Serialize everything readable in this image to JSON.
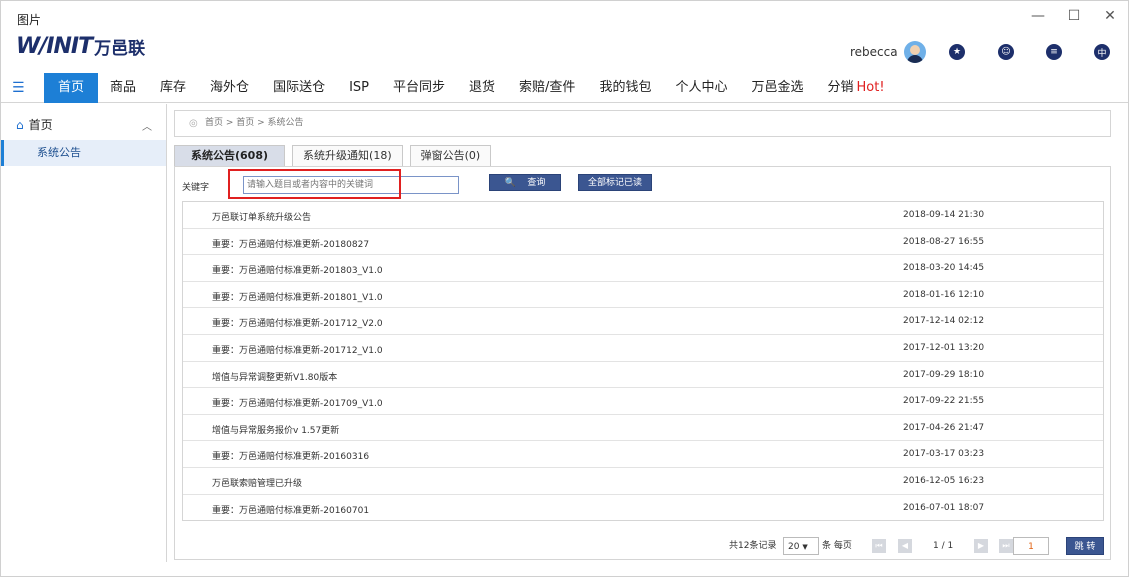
{
  "window": {
    "title": "图片",
    "minimize": "—",
    "maximize": "☐",
    "close": "✕"
  },
  "brand": {
    "mark": "W/INIT",
    "name": "万邑联"
  },
  "user": {
    "name": "rebecca",
    "icons": [
      "folder-star-icon",
      "support-agent-icon",
      "message-icon",
      "language-icon"
    ],
    "lang": "中"
  },
  "nav": {
    "menu_icon": "☰",
    "items": [
      "首页",
      "商品",
      "库存",
      "海外仓",
      "国际送仓",
      "ISP",
      "平台同步",
      "退货",
      "索赔/查件",
      "我的钱包",
      "个人中心",
      "万邑金选",
      "分销"
    ],
    "hot": "Hot!"
  },
  "sidebar": {
    "home": "首页",
    "home_icon": "⌂",
    "caret": "︿",
    "sub": "系统公告"
  },
  "breadcrumb": {
    "pin": "◎",
    "text": "首页 > 首页 > 系统公告"
  },
  "tabs": [
    "系统公告(608)",
    "系统升级通知(18)",
    "弹窗公告(0)"
  ],
  "search": {
    "label": "关键字",
    "placeholder": "请输入题目或者内容中的关键词",
    "search_label": "查询",
    "search_icon": "🔍",
    "markall_label": "全部标记已读"
  },
  "announcements": [
    {
      "title": "万邑联订单系统升级公告",
      "date": "2018-09-14 21:30"
    },
    {
      "title": "重要：万邑通赔付标准更新-20180827",
      "date": "2018-08-27 16:55"
    },
    {
      "title": "重要：万邑通赔付标准更新-201803_V1.0",
      "date": "2018-03-20 14:45"
    },
    {
      "title": "重要：万邑通赔付标准更新-201801_V1.0",
      "date": "2018-01-16 12:10"
    },
    {
      "title": "重要：万邑通赔付标准更新-201712_V2.0",
      "date": "2017-12-14 02:12"
    },
    {
      "title": "重要：万邑通赔付标准更新-201712_V1.0",
      "date": "2017-12-01 13:20"
    },
    {
      "title": "增值与异常调整更新V1.80版本",
      "date": "2017-09-29 18:10"
    },
    {
      "title": "重要：万邑通赔付标准更新-201709_V1.0",
      "date": "2017-09-22 21:55"
    },
    {
      "title": "增值与异常服务报价v 1.57更新",
      "date": "2017-04-26 21:47"
    },
    {
      "title": "重要：万邑通赔付标准更新-20160316",
      "date": "2017-03-17 03:23"
    },
    {
      "title": "万邑联索赔管理已升级",
      "date": "2016-12-05 16:23"
    },
    {
      "title": "重要：万邑通赔付标准更新-20160701",
      "date": "2016-07-01 18:07"
    }
  ],
  "pager": {
    "total": "共12条记录",
    "page_size": "20",
    "size_caret": "▼",
    "per_page": "条 每页",
    "first": "⏮",
    "prev": "◀",
    "page_info": "1 / 1",
    "next": "▶",
    "last": "⏭",
    "page_value": "1",
    "go_label": "跳 转"
  }
}
